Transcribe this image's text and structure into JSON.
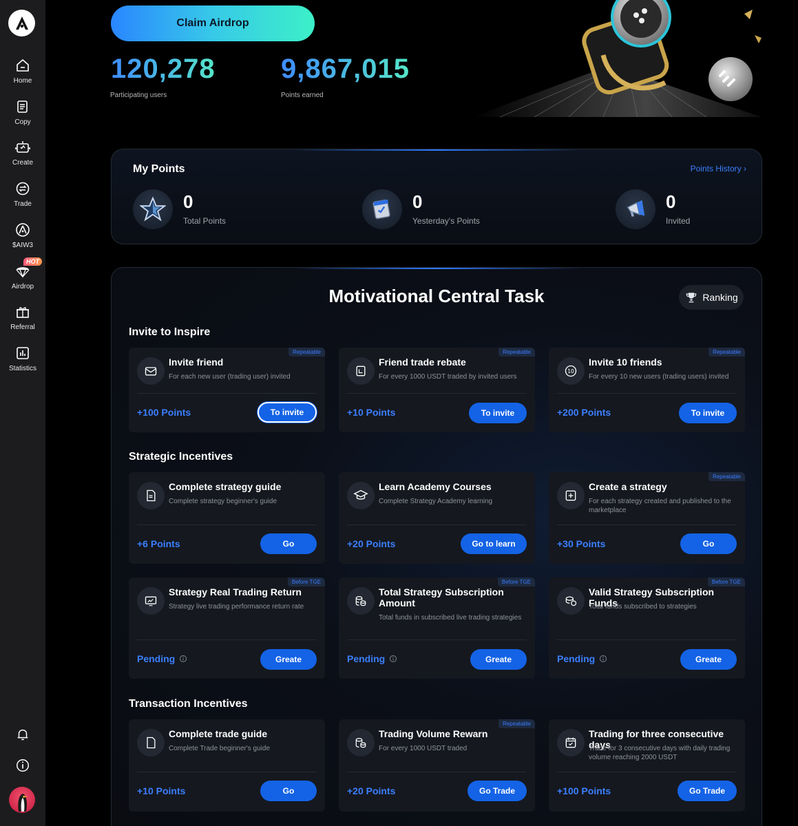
{
  "sidebar": {
    "items": [
      {
        "label": "Home",
        "icon": "home-icon"
      },
      {
        "label": "Copy",
        "icon": "copy-icon"
      },
      {
        "label": "Create",
        "icon": "robot-icon"
      },
      {
        "label": "Trade",
        "icon": "trade-icon"
      },
      {
        "label": "$AIW3",
        "icon": "aiw3-icon"
      },
      {
        "label": "Airdrop",
        "icon": "airdrop-icon",
        "badge": "HOT"
      },
      {
        "label": "Referral",
        "icon": "gift-icon"
      },
      {
        "label": "Statistics",
        "icon": "chart-icon"
      }
    ]
  },
  "hero": {
    "claim_label": "Claim Airdrop",
    "participating_value": "120,278",
    "participating_label": "Participating users",
    "points_value": "9,867,015",
    "points_label": "Points earned"
  },
  "my_points": {
    "title": "My Points",
    "history_label": "Points History ›",
    "items": [
      {
        "value": "0",
        "label": "Total Points",
        "icon": "star-icon"
      },
      {
        "value": "0",
        "label": "Yesterday's Points",
        "icon": "calendar-icon"
      },
      {
        "value": "0",
        "label": "Invited",
        "icon": "megaphone-icon"
      }
    ]
  },
  "tasks": {
    "title": "Motivational Central Task",
    "ranking_label": "Ranking",
    "sections": [
      {
        "title": "Invite to Inspire",
        "cards": [
          {
            "title": "Invite friend",
            "desc": "For each new user (trading user) invited",
            "tag": "Repeatable",
            "points": "+100 Points",
            "button": "To invite",
            "icon": "mail-icon"
          },
          {
            "title": "Friend trade rebate",
            "desc": "For every 1000 USDT traded by invited users",
            "tag": "Repeatable",
            "points": "+10 Points",
            "button": "To invite",
            "icon": "document-icon"
          },
          {
            "title": "Invite 10 friends",
            "desc": "For every 10 new users (trading users) invited",
            "tag": "Repeatable",
            "points": "+200 Points",
            "button": "To invite",
            "icon": "ten-icon"
          }
        ]
      },
      {
        "title": "Strategic Incentives",
        "cards": [
          {
            "title": "Complete strategy guide",
            "desc": "Complete strategy beginner's guide",
            "tag": "",
            "points": "+6 Points",
            "button": "Go",
            "icon": "file-icon"
          },
          {
            "title": "Learn Academy Courses",
            "desc": "Complete Strategy Academy learning",
            "tag": "",
            "points": "+20 Points",
            "button": "Go to learn",
            "icon": "graduation-cap-icon"
          },
          {
            "title": "Create a strategy",
            "desc": "For each strategy created and published to the marketplace",
            "tag": "Repeatable",
            "points": "+30 Points",
            "button": "Go",
            "icon": "plus-square-icon"
          },
          {
            "title": "Strategy Real Trading Return",
            "desc": "Strategy live trading performance return rate",
            "tag": "Before TGE",
            "points": "Pending",
            "button": "Greate",
            "icon": "monitor-chart-icon"
          },
          {
            "title": "Total Strategy Subscription Amount",
            "desc": "Total funds in subscribed live trading strategies",
            "tag": "Before TGE",
            "points": "Pending",
            "button": "Greate",
            "icon": "coins-icon"
          },
          {
            "title": "Valid Strategy Subscription Funds",
            "desc": "Total funds subscribed to strategies",
            "tag": "Before TGE",
            "points": "Pending",
            "button": "Greate",
            "icon": "coins-stack-icon"
          }
        ]
      },
      {
        "title": "Transaction Incentives",
        "cards": [
          {
            "title": "Complete trade guide",
            "desc": "Complete Trade beginner's guide",
            "tag": "",
            "points": "+10 Points",
            "button": "Go",
            "icon": "file-icon"
          },
          {
            "title": "Trading Volume Rewarn",
            "desc": "For every 1000 USDT traded",
            "tag": "Repeatable",
            "points": "+20 Points",
            "button": "Go Trade",
            "icon": "coins-icon"
          },
          {
            "title": "Trading for three consecutive days",
            "desc": "Trade for 3 consecutive days with daily trading volume reaching 2000 USDT",
            "tag": "",
            "points": "+100 Points",
            "button": "Go Trade",
            "icon": "calendar-check-icon"
          }
        ]
      }
    ]
  },
  "colors": {
    "accent": "#1463e6",
    "link": "#3b7fff",
    "sidebar_bg": "#1c1c1e"
  }
}
